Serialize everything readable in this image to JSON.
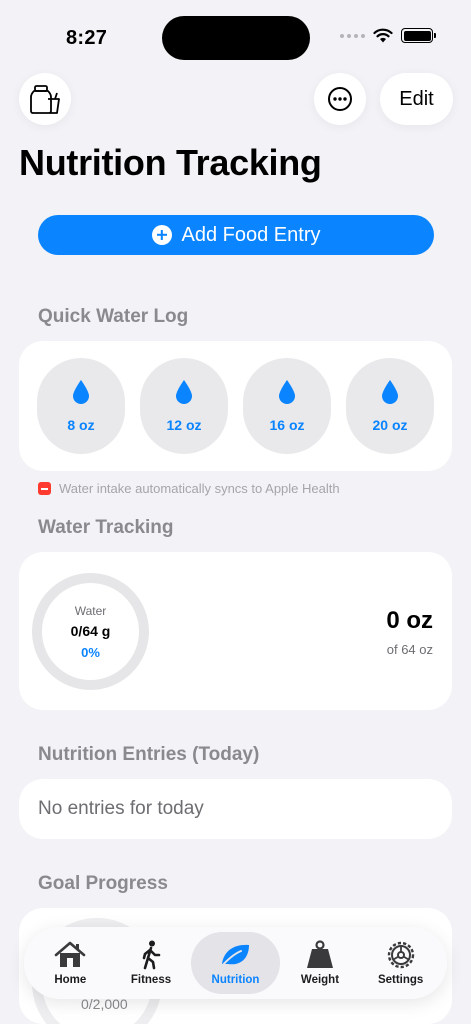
{
  "status_bar": {
    "time": "8:27"
  },
  "nav": {
    "edit_label": "Edit"
  },
  "page": {
    "title": "Nutrition Tracking"
  },
  "actions": {
    "add_food_label": "Add Food Entry"
  },
  "quick_water": {
    "header": "Quick Water Log",
    "options": [
      "8 oz",
      "12 oz",
      "16 oz",
      "20 oz"
    ],
    "sync_note": "Water intake automatically syncs to Apple Health"
  },
  "water_tracking": {
    "header": "Water Tracking",
    "ring_label": "Water",
    "ring_value": "0/64 g",
    "ring_percent": "0%",
    "progress_fraction": 0,
    "amount": "0 oz",
    "goal": "of 64 oz"
  },
  "entries": {
    "header": "Nutrition Entries (Today)",
    "empty_text": "No entries for today"
  },
  "goal_progress": {
    "header": "Goal Progress",
    "value": "0/2,000"
  },
  "tab_bar": {
    "tabs": [
      {
        "label": "Home",
        "icon": "house-icon"
      },
      {
        "label": "Fitness",
        "icon": "figure-walk-icon"
      },
      {
        "label": "Nutrition",
        "icon": "leaf-icon"
      },
      {
        "label": "Weight",
        "icon": "scale-weight-icon"
      },
      {
        "label": "Settings",
        "icon": "gear-icon"
      }
    ],
    "active_index": 2
  },
  "colors": {
    "accent": "#0a84ff",
    "background": "#f2f2f7",
    "card": "#ffffff",
    "secondary_text": "#8a8a8e",
    "health_red": "#ff3b30"
  }
}
